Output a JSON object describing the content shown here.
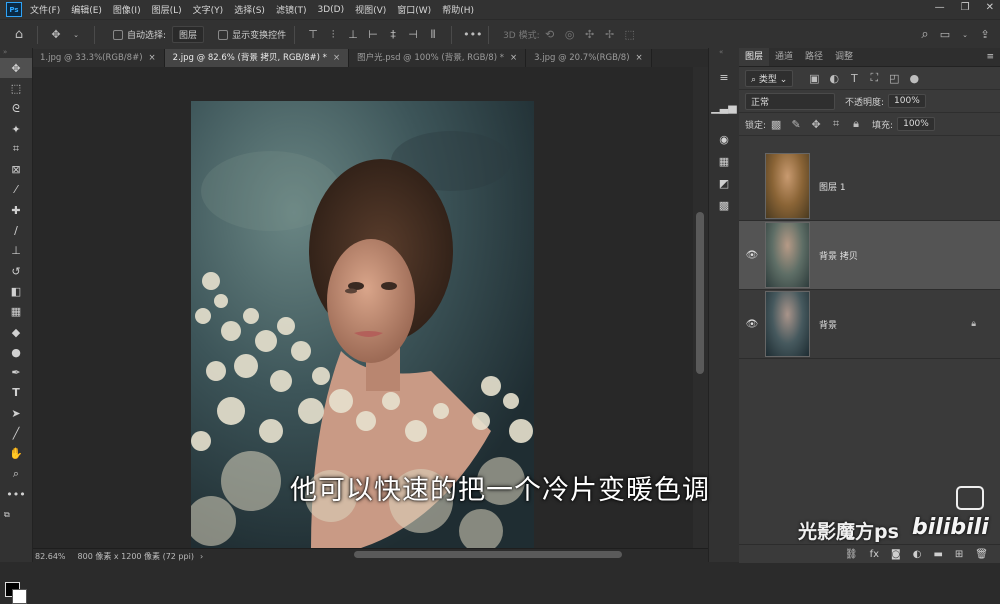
{
  "app": {
    "logo": "Ps"
  },
  "menu": [
    "文件(F)",
    "编辑(E)",
    "图像(I)",
    "图层(L)",
    "文字(Y)",
    "选择(S)",
    "滤镜(T)",
    "3D(D)",
    "视图(V)",
    "窗口(W)",
    "帮助(H)"
  ],
  "options": {
    "auto_select_label": "自动选择:",
    "auto_select_value": "图层",
    "show_transform_label": "显示变换控件",
    "mode_3d_label": "3D 模式:"
  },
  "tabs": [
    {
      "label": "1.jpg @ 33.3%(RGB/8#)",
      "close": "×"
    },
    {
      "label": "2.jpg @ 82.6% (背景 拷贝, RGB/8#) *",
      "close": "×"
    },
    {
      "label": "图户光.psd @ 100% (背景, RGB/8) *",
      "close": "×"
    },
    {
      "label": "3.jpg @ 20.7%(RGB/8)",
      "close": "×"
    }
  ],
  "status": {
    "zoom": "82.64%",
    "doc_info": "800 像素 x 1200 像素 (72 ppi)"
  },
  "layers_panel": {
    "tabs": [
      "图层",
      "通道",
      "路径",
      "调整"
    ],
    "filter_kind": "类型",
    "blend_mode": "正常",
    "opacity_label": "不透明度:",
    "opacity_value": "100%",
    "lock_label": "锁定:",
    "fill_label": "填充:",
    "fill_value": "100%",
    "layers": [
      {
        "name": "图层 1",
        "visible": false,
        "selected": false,
        "locked": false
      },
      {
        "name": "背景 拷贝",
        "visible": true,
        "selected": true,
        "locked": false
      },
      {
        "name": "背景",
        "visible": true,
        "selected": false,
        "locked": true
      }
    ]
  },
  "overlay": {
    "subtitle": "他可以快速的把一个冷片变暖色调",
    "watermark": "光影魔方ps",
    "platform_logo": "bilibili"
  },
  "colors": {
    "accent": "#31a8ff",
    "panel_bg": "#3a3a3a",
    "chrome": "#323232"
  }
}
